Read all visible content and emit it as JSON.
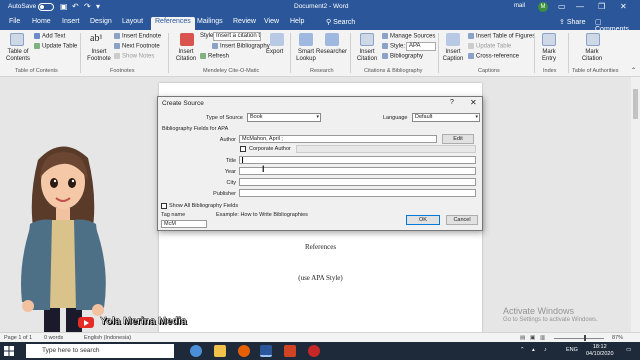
{
  "titlebar": {
    "autosave": "AutoSave",
    "autosave_state": "Off",
    "document_title": "Document2 - Word",
    "user_name": "mail",
    "user_initial": "M"
  },
  "tabs": [
    "File",
    "Home",
    "Insert",
    "Design",
    "Layout",
    "References",
    "Mailings",
    "Review",
    "View",
    "Help"
  ],
  "active_tab": "References",
  "search_label": "Search",
  "share_label": "Share",
  "comments_label": "Comments",
  "ribbon": {
    "toc": "Table of Contents",
    "add_text": "Add Text",
    "update_table": "Update Table",
    "insert_footnote": "Insert Footnote",
    "insert_endnote": "Insert Endnote",
    "next_footnote": "Next Footnote",
    "show_notes": "Show Notes",
    "insert_citation_mendeley": "Insert Citation",
    "style_label": "Style:",
    "style_value": "Insert a citation t...",
    "insert_bibliography": "Insert Bibliography",
    "refresh": "Refresh",
    "export": "Export",
    "smart_lookup": "Smart Lookup",
    "researcher": "Researcher",
    "insert_citation": "Insert Citation",
    "manage_sources": "Manage Sources",
    "style2_label": "Style:",
    "style2_value": "APA",
    "bibliography": "Bibliography",
    "insert_caption": "Insert Caption",
    "insert_table_of_figures": "Insert Table of Figures",
    "update_table2": "Update Table",
    "cross_reference": "Cross-reference",
    "mark_entry": "Mark Entry",
    "mark_citation": "Mark Citation",
    "groups": {
      "toc": "Table of Contents",
      "footnotes": "Footnotes",
      "mendeley": "Mendeley Cite-O-Matic",
      "research": "Research",
      "citations": "Citations & Bibliography",
      "captions": "Captions",
      "index": "Index",
      "toa": "Table of Authorities"
    }
  },
  "dialog": {
    "title": "Create Source",
    "help": "?",
    "type_label": "Type of Source",
    "type_value": "Book",
    "language_label": "Language",
    "language_value": "Default",
    "fields_header": "Bibliography Fields for APA",
    "author_label": "Author",
    "author_value": "McMahon, April ;",
    "edit_button": "Edit",
    "corporate_label": "Corporate Author",
    "title_label": "Title",
    "year_label": "Year",
    "city_label": "City",
    "publisher_label": "Publisher",
    "show_all_label": "Show All Bibliography Fields",
    "tag_name_label": "Tag name",
    "tag_value": "McM",
    "example_text": "Example: How to Write Bibliographies",
    "ok_button": "OK",
    "cancel_button": "Cancel"
  },
  "document": {
    "heading": "References",
    "subtitle": "(use APA Style)"
  },
  "brand": "Yola Merina Media",
  "status": {
    "page": "Page 1 of 1",
    "words": "0 words",
    "language": "English (Indonesia)",
    "zoom": "87%"
  },
  "watermark": {
    "line1": "Activate Windows",
    "line2": "Go to Settings to activate Windows."
  },
  "taskbar": {
    "search_placeholder": "Type here to search",
    "lang": "ENG",
    "time": "18:12",
    "date": "04/10/2020"
  },
  "colors": {
    "word_blue": "#2b579a",
    "youtube_red": "#e52d27"
  }
}
